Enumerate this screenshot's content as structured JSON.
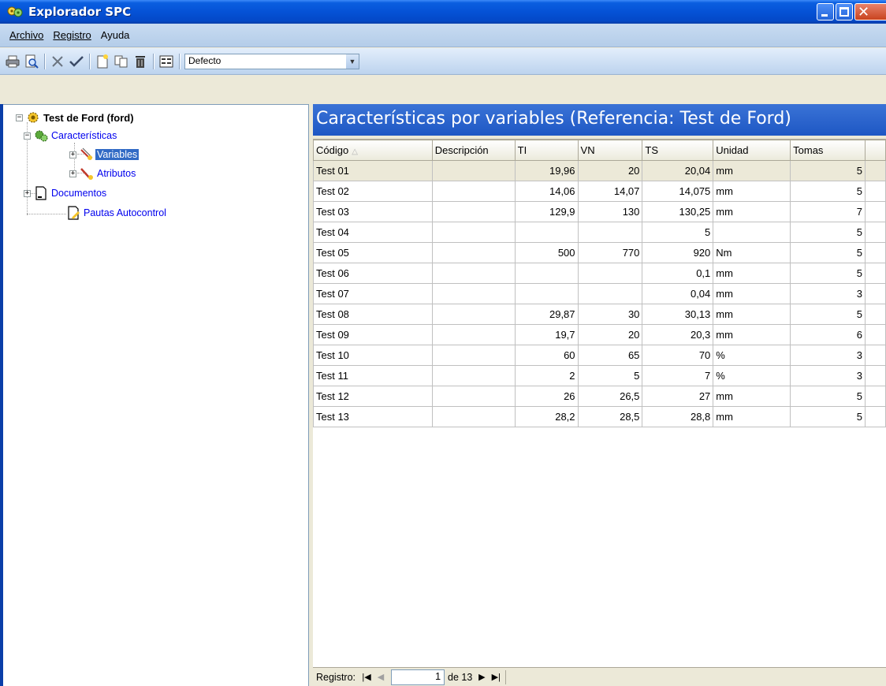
{
  "window": {
    "title": "Explorador SPC",
    "colors": {
      "titlebar": "#0552d6",
      "selection": "#316ac5",
      "link": "#0000ee"
    }
  },
  "menu": [
    {
      "label": "Archivo",
      "accel": "A"
    },
    {
      "label": "Registro",
      "accel": "R"
    },
    {
      "label": "Ayuda",
      "accel": "u"
    }
  ],
  "toolbar": {
    "icons": [
      "printer-icon",
      "print-preview-icon",
      "delete-x-icon",
      "check-icon",
      "new-document-icon",
      "copy-icon",
      "trash-icon",
      "form-view-icon"
    ],
    "view_combo": {
      "value": "Defecto"
    }
  },
  "tree": {
    "root": {
      "label": "Test de Ford (ford)",
      "icon": "gear-icon"
    },
    "caracteristicas": {
      "label": "Características",
      "icon": "gears-icon"
    },
    "variables": {
      "label": "Variables",
      "icon": "caliper-icon"
    },
    "atributos": {
      "label": "Atributos",
      "icon": "checkmark-red-icon"
    },
    "documentos": {
      "label": "Documentos",
      "icon": "document-icon"
    },
    "pautas": {
      "label": "Pautas Autocontrol",
      "icon": "document-pen-icon"
    }
  },
  "pane": {
    "title": "Características por variables (Referencia: Test de Ford)"
  },
  "grid": {
    "columns": [
      "Código",
      "Descripción",
      "TI",
      "VN",
      "TS",
      "Unidad",
      "Tomas"
    ],
    "rows": [
      [
        "Test 01",
        "",
        "19,96",
        "20",
        "20,04",
        "mm",
        "5"
      ],
      [
        "Test 02",
        "",
        "14,06",
        "14,07",
        "14,075",
        "mm",
        "5"
      ],
      [
        "Test 03",
        "",
        "129,9",
        "130",
        "130,25",
        "mm",
        "7"
      ],
      [
        "Test 04",
        "",
        "",
        "",
        "5",
        "",
        "5"
      ],
      [
        "Test 05",
        "",
        "500",
        "770",
        "920",
        "Nm",
        "5"
      ],
      [
        "Test 06",
        "",
        "",
        "",
        "0,1",
        "mm",
        "5"
      ],
      [
        "Test 07",
        "",
        "",
        "",
        "0,04",
        "mm",
        "3"
      ],
      [
        "Test 08",
        "",
        "29,87",
        "30",
        "30,13",
        "mm",
        "5"
      ],
      [
        "Test 09",
        "",
        "19,7",
        "20",
        "20,3",
        "mm",
        "6"
      ],
      [
        "Test 10",
        "",
        "60",
        "65",
        "70",
        "%",
        "3"
      ],
      [
        "Test 11",
        "",
        "2",
        "5",
        "7",
        "%",
        "3"
      ],
      [
        "Test 12",
        "",
        "26",
        "26,5",
        "27",
        "mm",
        "5"
      ],
      [
        "Test 13",
        "",
        "28,2",
        "28,5",
        "28,8",
        "mm",
        "5"
      ]
    ],
    "selected_row": 0
  },
  "navigator": {
    "label": "Registro:",
    "position": "1",
    "of_text": "de 13"
  }
}
